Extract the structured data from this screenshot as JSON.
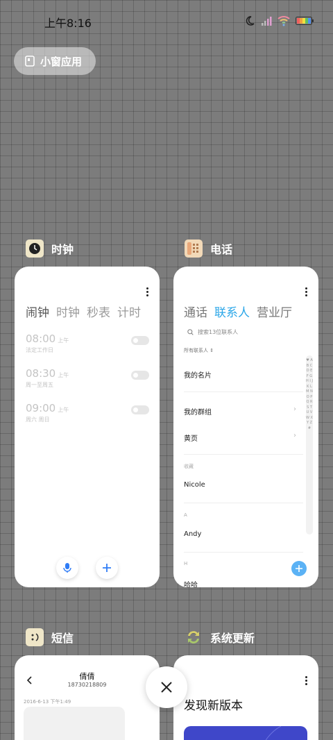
{
  "status": {
    "time": "上午8:16"
  },
  "pill": {
    "label": "小窗应用"
  },
  "clock": {
    "app_name": "时钟",
    "tabs": [
      "闹钟",
      "时钟",
      "秒表",
      "计时"
    ],
    "alarms": [
      {
        "time": "08:00",
        "ampm": "上午",
        "label": "法定工作日"
      },
      {
        "time": "08:30",
        "ampm": "上午",
        "label": "周一至周五"
      },
      {
        "time": "09:00",
        "ampm": "上午",
        "label": "周六 周日"
      }
    ]
  },
  "phone": {
    "app_name": "电话",
    "tabs": [
      "通话",
      "联系人",
      "营业厅"
    ],
    "search_placeholder": "搜索13位联系人",
    "filter": "所有联系人",
    "my_card": "我的名片",
    "my_groups": "我的群组",
    "yellow_pages": "黄页",
    "section_fav": "收藏",
    "fav_name": "Nicole",
    "section_a": "A",
    "a_name": "Andy",
    "section_h": "H",
    "h_name": "哈哈",
    "alphabet": "♥ A B C D E F G H I J K L M N O P Q R S T U V W X Y Z #"
  },
  "sms": {
    "app_name": "短信",
    "contact_name": "倩倩",
    "contact_number": "18730218809",
    "timestamp": "2016-6-13 下午1:49"
  },
  "update": {
    "app_name": "系统更新",
    "headline": "发现新版本"
  },
  "colors": {
    "accent": "#2f7cf6",
    "phone_accent": "#2aa6e8",
    "fab_blue": "#5bb2f5",
    "banner": "#3f47c9"
  }
}
